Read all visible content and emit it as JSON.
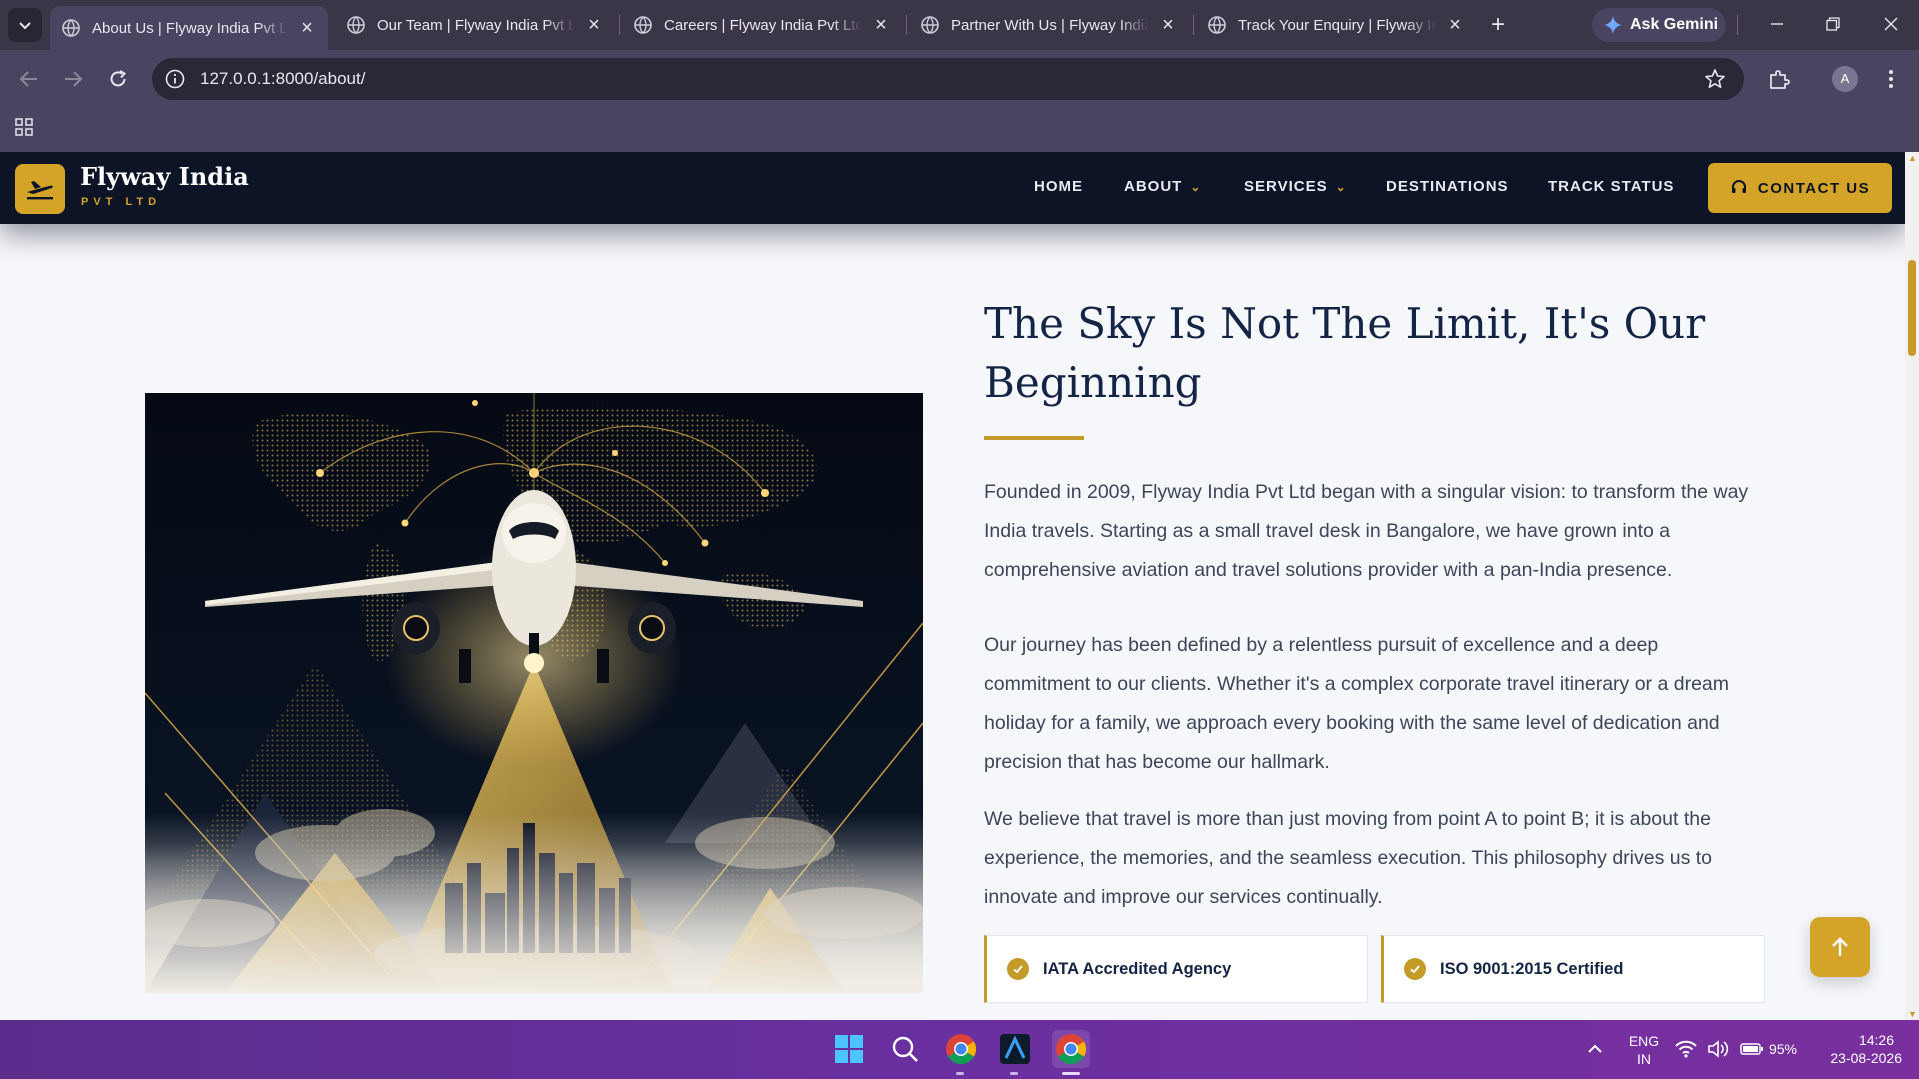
{
  "browser": {
    "tabs": [
      {
        "title": "About Us | Flyway India Pvt Ltd"
      },
      {
        "title": "Our Team | Flyway India Pvt Ltd"
      },
      {
        "title": "Careers | Flyway India Pvt Ltd"
      },
      {
        "title": "Partner With Us | Flyway India"
      },
      {
        "title": "Track Your Enquiry | Flyway India"
      }
    ],
    "gemini_label": "Ask Gemini",
    "url": "127.0.0.1:8000/about/",
    "profile_initial": "A"
  },
  "site": {
    "brand_name": "Flyway India",
    "brand_sub": "PVT LTD",
    "nav": {
      "home": "HOME",
      "about": "ABOUT",
      "services": "SERVICES",
      "destinations": "DESTINATIONS",
      "track": "TRACK STATUS",
      "contact": "CONTACT US"
    },
    "colors": {
      "navy": "#0c1426",
      "gold": "#d4a429",
      "heading": "#142445"
    }
  },
  "about": {
    "heading_line1": "The Sky Is Not The Limit, It's Our",
    "heading_line2": "Beginning",
    "paragraphs": [
      "Founded in 2009, Flyway India Pvt Ltd began with a singular vision: to transform the way India travels. Starting as a small travel desk in Bangalore, we have grown into a comprehensive aviation and travel solutions provider with a pan-India presence.",
      "Our journey has been defined by a relentless pursuit of excellence and a deep commitment to our clients. Whether it's a complex corporate travel itinerary or a dream holiday for a family, we approach every booking with the same level of dedication and precision that has become our hallmark.",
      "We believe that travel is more than just moving from point A to point B; it is about the experience, the memories, and the seamless execution. This philosophy drives us to innovate and improve our services continually."
    ],
    "features": [
      "IATA Accredited Agency",
      "ISO 9001:2015 Certified"
    ]
  },
  "taskbar": {
    "lang_line1": "ENG",
    "lang_line2": "IN",
    "battery": "95%",
    "time": "14:26",
    "date": "23-08-2026"
  }
}
